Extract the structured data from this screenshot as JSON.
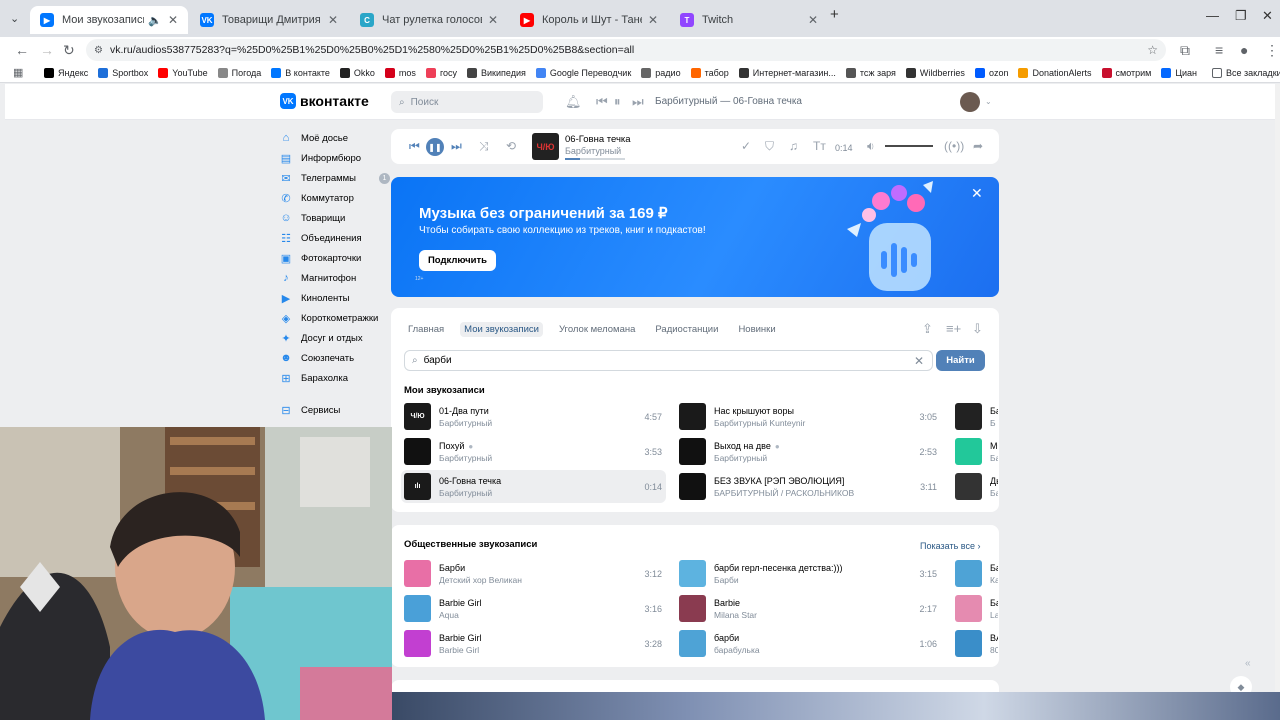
{
  "browser": {
    "tabs": [
      {
        "title": "Мои звукозаписи",
        "icon": "vk-video-icon",
        "color": "#0077ff",
        "active": true
      },
      {
        "title": "Товарищи Дмитрия Зорина –",
        "icon": "vk-icon",
        "color": "#0077ff"
      },
      {
        "title": "Чат рулетка голосовая — Nek",
        "icon": "chat-icon",
        "color": "#2aa6c8"
      },
      {
        "title": "Король и Шут - Танец злобнс",
        "icon": "youtube-icon",
        "color": "#ff0000"
      },
      {
        "title": "Twitch",
        "icon": "twitch-icon",
        "color": "#9146ff"
      }
    ],
    "new_tab": "+",
    "url": "vk.ru/audios538775283?q=%25D0%25B1%25D0%25B0%25D1%2580%25D0%25B1%25D0%25B8&section=all",
    "bookmarks": [
      {
        "label": "Яндекс",
        "color": "#000000"
      },
      {
        "label": "Sportbox",
        "color": "#1e6fd9"
      },
      {
        "label": "YouTube",
        "color": "#ff0000"
      },
      {
        "label": "Погода",
        "color": "#888888"
      },
      {
        "label": "В контакте",
        "color": "#0077ff"
      },
      {
        "label": "Okko",
        "color": "#222222"
      },
      {
        "label": "mos",
        "color": "#d4001a"
      },
      {
        "label": "госу",
        "color": "#ee3f58"
      },
      {
        "label": "Википедия",
        "color": "#444444"
      },
      {
        "label": "Google Переводчик",
        "color": "#4285f4"
      },
      {
        "label": "радио",
        "color": "#666666"
      },
      {
        "label": "табор",
        "color": "#ff6600"
      },
      {
        "label": "Интернет-магазин...",
        "color": "#333333"
      },
      {
        "label": "тсж заря",
        "color": "#555555"
      },
      {
        "label": "Wildberries",
        "color": "#333333"
      },
      {
        "label": "ozon",
        "color": "#005bff"
      },
      {
        "label": "DonationAlerts",
        "color": "#f59c00"
      },
      {
        "label": "смотрим",
        "color": "#c8102e"
      },
      {
        "label": "Циан",
        "color": "#0468ff"
      }
    ],
    "all_bookmarks": "Все закладки"
  },
  "vk": {
    "logo": "вконтакте",
    "search_placeholder": "Поиск",
    "header_track": "Барбитурный — 06-Говна течка",
    "sidebar": [
      {
        "label": "Моё досье",
        "icon": "home-icon"
      },
      {
        "label": "Информбюро",
        "icon": "news-icon"
      },
      {
        "label": "Телеграммы",
        "icon": "messages-icon",
        "count": "1"
      },
      {
        "label": "Коммутатор",
        "icon": "phone-icon"
      },
      {
        "label": "Товарищи",
        "icon": "friends-icon"
      },
      {
        "label": "Объединения",
        "icon": "groups-icon"
      },
      {
        "label": "Фотокарточки",
        "icon": "photos-icon"
      },
      {
        "label": "Магнитофон",
        "icon": "music-icon"
      },
      {
        "label": "Киноленты",
        "icon": "video-icon"
      },
      {
        "label": "Короткометражки",
        "icon": "clips-icon"
      },
      {
        "label": "Досуг и отдых",
        "icon": "games-icon"
      },
      {
        "label": "Союзпечать",
        "icon": "stickers-icon"
      },
      {
        "label": "Барахолка",
        "icon": "market-icon"
      },
      {
        "label": "Сервисы",
        "icon": "services-icon"
      }
    ],
    "player": {
      "title": "06-Говна течка",
      "artist": "Барбитурный",
      "time": "0:14",
      "cover_text": "Ч/Ю",
      "progress": 0.25
    },
    "banner": {
      "title": "Музыка без ограничений за 169 ₽",
      "subtitle": "Чтобы собирать свою коллекцию из треков, книг и подкастов!",
      "button": "Подключить",
      "age": "12+"
    },
    "tabs": [
      "Главная",
      "Мои звукозаписи",
      "Уголок меломана",
      "Радиостанции",
      "Новинки"
    ],
    "search_value": "барби",
    "find_button": "Найти",
    "my_title": "Мои звукозаписи",
    "my_tracks": [
      {
        "title": "01-Два пути",
        "artist": "Барбитурный",
        "duration": "4:57",
        "cover": "#1a1a1a",
        "cover_text": "Ч/Ю"
      },
      {
        "title": "Нас крышуют воры",
        "artist": "Барбитурный Kunteynir",
        "duration": "3:05",
        "cover": "#1a1a1a",
        "cover_text": ""
      },
      {
        "title": "Похуй",
        "artist": "Барбитурный",
        "duration": "3:53",
        "cover": "#111111",
        "cover_text": "",
        "verified": true
      },
      {
        "title": "Выход на две",
        "artist": "Барбитурный",
        "duration": "2:53",
        "cover": "#111111",
        "cover_text": "",
        "verified": true
      },
      {
        "title": "06-Говна течка",
        "artist": "Барбитурный",
        "duration": "0:14",
        "cover": "#1a1a1a",
        "cover_text": "ılı",
        "playing": true
      },
      {
        "title": "БЕЗ ЗВУКА [РЭП ЭВОЛЮЦИЯ]",
        "artist": "БАРБИТУРНЫЙ / РАСКОЛЬНИКОВ",
        "duration": "3:11",
        "cover": "#111111",
        "cover_text": ""
      }
    ],
    "my_cut": [
      {
        "title": "Ба",
        "artist": "Б",
        "cover": "#222222"
      },
      {
        "title": "МО",
        "artist": "Ба",
        "cover": "#22c89a"
      },
      {
        "title": "Ды",
        "artist": "Ба",
        "cover": "#333333"
      }
    ],
    "public_title": "Общественные звукозаписи",
    "show_all": "Показать все",
    "public_tracks": [
      {
        "title": "Барби",
        "artist": "Детский хор Великан",
        "duration": "3:12",
        "cover": "#e86fa6"
      },
      {
        "title": "барби герл-песенка детства:)))",
        "artist": "Барби",
        "duration": "3:15",
        "cover": "#5db3e0"
      },
      {
        "title": "Barbie Girl",
        "artist": "Aqua",
        "duration": "3:16",
        "cover": "#4aa0d8"
      },
      {
        "title": "Barbie",
        "artist": "Milana Star",
        "duration": "2:17",
        "cover": "#8a3b50"
      },
      {
        "title": "Barbie Girl",
        "artist": "Barbie Girl",
        "duration": "3:28",
        "cover": "#c23fd1"
      },
      {
        "title": "барби",
        "artist": "барабулька",
        "duration": "1:06",
        "cover": "#4ea3d6"
      }
    ],
    "public_cut": [
      {
        "title": "Ба",
        "artist": "Ка",
        "cover": "#4ea3d6"
      },
      {
        "title": "Ба",
        "artist": "La",
        "cover": "#e58bb0"
      },
      {
        "title": "BA",
        "artist": "80",
        "cover": "#3a8ec9"
      }
    ]
  },
  "colors": {
    "accent": "#5181b8",
    "vk_blue": "#0077ff",
    "banner": "#0a74f5"
  }
}
